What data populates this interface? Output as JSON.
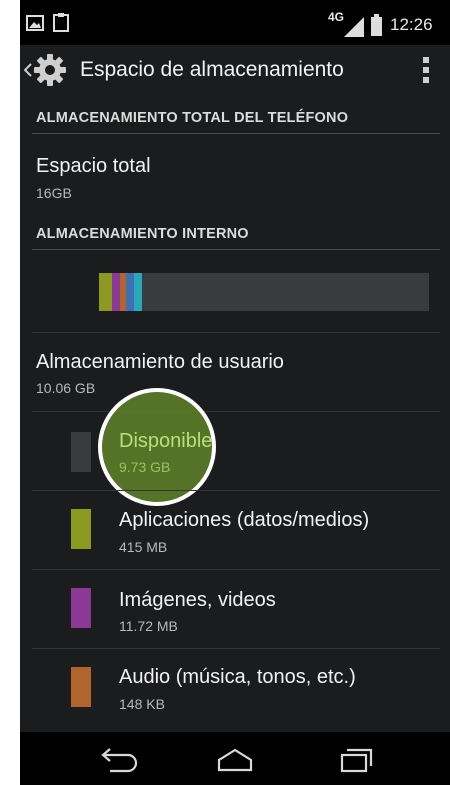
{
  "status_bar": {
    "network": "4G",
    "time": "12:26",
    "icons": [
      "image-notification-icon",
      "clipboard-notification-icon",
      "signal-icon",
      "battery-icon"
    ]
  },
  "action_bar": {
    "title": "Espacio de almacenamiento",
    "icons": [
      "back-chevron-icon",
      "settings-gear-icon",
      "overflow-menu-icon"
    ]
  },
  "sections": {
    "total_header": "ALMACENAMIENTO TOTAL DEL TELÉFONO",
    "internal_header": "ALMACENAMIENTO INTERNO"
  },
  "total": {
    "title": "Espacio total",
    "value": "16GB"
  },
  "storage_bar": {
    "background": "#3a3b3d",
    "segments": [
      {
        "color": "#8b9a1e"
      },
      {
        "color": "#8a3a96"
      },
      {
        "color": "#b1642c"
      },
      {
        "color": "#3f6fb5"
      },
      {
        "color": "#2aa7b8"
      }
    ]
  },
  "user_storage": {
    "title": "Almacenamiento de usuario",
    "value": "10.06 GB"
  },
  "items": [
    {
      "title": "Disponible",
      "value": "9.73 GB",
      "color": "#3a3b3d"
    },
    {
      "title": "Aplicaciones (datos/medios)",
      "value": "415 MB",
      "color": "#8b9a1e"
    },
    {
      "title": "Imágenes, videos",
      "value": "11.72 MB",
      "color": "#8a3a96"
    },
    {
      "title": "Audio (música, tonos, etc.)",
      "value": "148 KB",
      "color": "#b1642c"
    }
  ],
  "nav_bar": {
    "icons": [
      "back-icon",
      "home-icon",
      "recents-icon"
    ]
  }
}
